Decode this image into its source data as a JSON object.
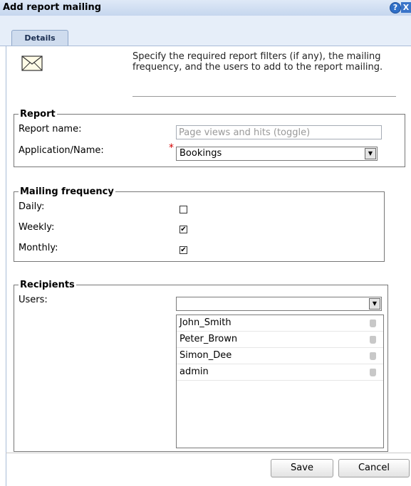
{
  "dialog": {
    "title": "Add report mailing",
    "help_icon": "?",
    "close_icon": "X",
    "tab_details": "Details",
    "description": "Specify the required report filters (if any), the mailing frequency, and the users to add to the report mailing."
  },
  "report": {
    "legend": "Report",
    "name_label": "Report name:",
    "name_value": "Page views and hits (toggle)",
    "app_label": "Application/Name:",
    "app_required": "*",
    "app_value": "Bookings"
  },
  "frequency": {
    "legend": "Mailing frequency",
    "daily_label": "Daily:",
    "daily_checked": false,
    "weekly_label": "Weekly:",
    "weekly_checked": true,
    "monthly_label": "Monthly:",
    "monthly_checked": true
  },
  "recipients": {
    "legend": "Recipients",
    "users_label": "Users:",
    "users_select_value": "",
    "users": [
      "John_Smith",
      "Peter_Brown",
      "Simon_Dee",
      "admin"
    ]
  },
  "buttons": {
    "save": "Save",
    "cancel": "Cancel"
  },
  "icons": {
    "mail": "envelope-icon",
    "remove": "trash-icon",
    "help": "help-icon",
    "close": "close-icon"
  },
  "colors": {
    "title_bar": "#c5d6ee",
    "tab": "#cfdcee",
    "required": "#d40000"
  }
}
